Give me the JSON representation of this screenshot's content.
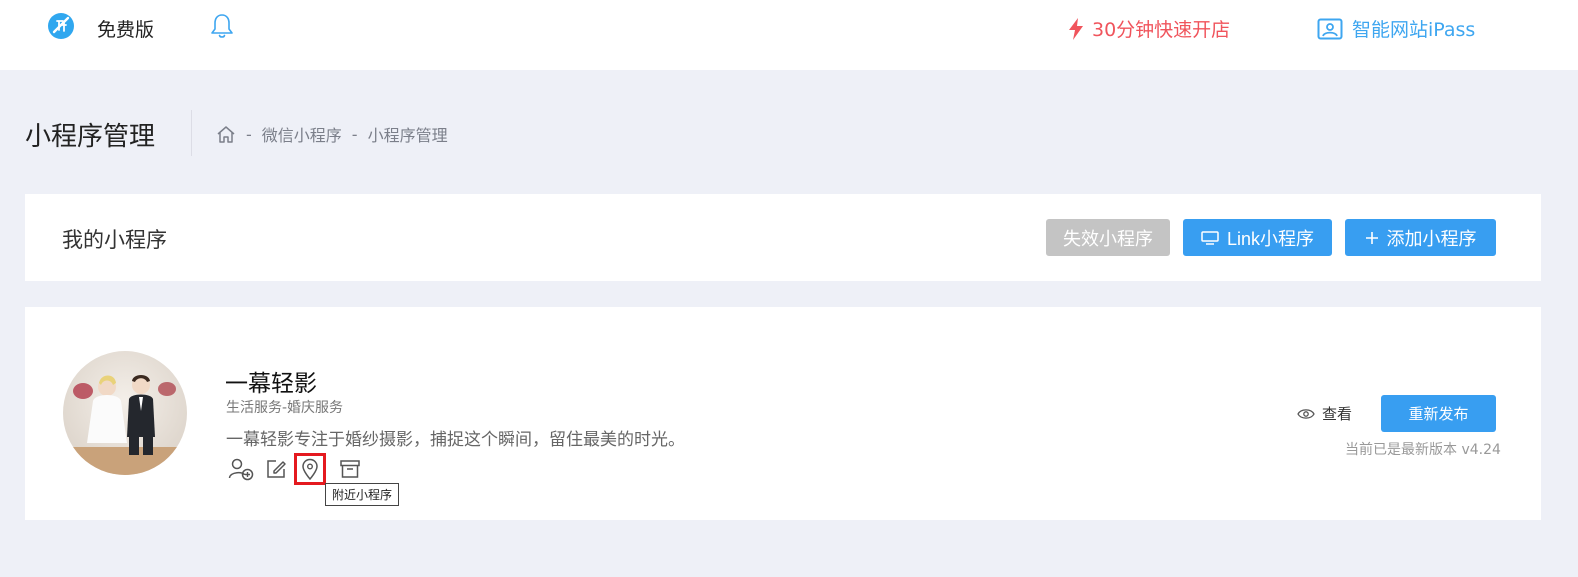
{
  "topbar": {
    "plan_label": "免费版",
    "promo_label": "30分钟快速开店",
    "ipass_label": "智能网站iPass",
    "logo_icon": "edition-logo-icon",
    "bell_icon": "bell-icon",
    "colors": {
      "promo": "#f0545c",
      "ipass": "#3ea6f0",
      "logo": "#30a7ef"
    }
  },
  "page": {
    "title": "小程序管理",
    "breadcrumb": [
      "微信小程序",
      "小程序管理"
    ],
    "breadcrumb_separator": "-",
    "home_icon": "home-icon"
  },
  "section": {
    "title": "我的小程序",
    "buttons": {
      "invalid": "失效小程序",
      "link": "Link小程序",
      "add": "添加小程序"
    },
    "colors": {
      "primary": "#389ef1",
      "disabled": "#c4c4c4"
    }
  },
  "app": {
    "name": "一幕轻影",
    "category": "生活服务-婚庆服务",
    "description": "一幕轻影专注于婚纱摄影，捕捉这个瞬间，留住最美的时光。",
    "actions": [
      "add-member-icon",
      "edit-icon",
      "location-pin-icon",
      "archive-box-icon"
    ],
    "tooltip": "附近小程序",
    "view_label": "查看",
    "republish_label": "重新发布",
    "version_note": "当前已是最新版本 v4.24"
  }
}
